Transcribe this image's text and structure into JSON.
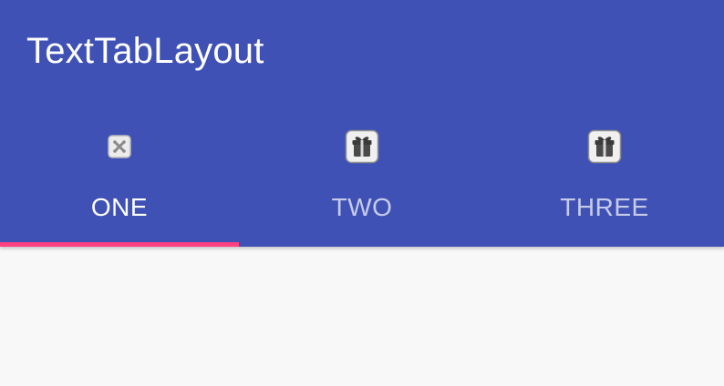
{
  "toolbar": {
    "title": "TextTabLayout"
  },
  "tabs": [
    {
      "label": "ONE",
      "icon": "close-badge-icon",
      "selected": true
    },
    {
      "label": "TWO",
      "icon": "gift-icon",
      "selected": false
    },
    {
      "label": "THREE",
      "icon": "gift-icon",
      "selected": false
    }
  ],
  "colors": {
    "primary": "#3f51b5",
    "accent": "#ff4081",
    "background": "#f8f8f8",
    "tab_text_selected": "#ffffff",
    "tab_text_unselected": "#c5cae9"
  }
}
